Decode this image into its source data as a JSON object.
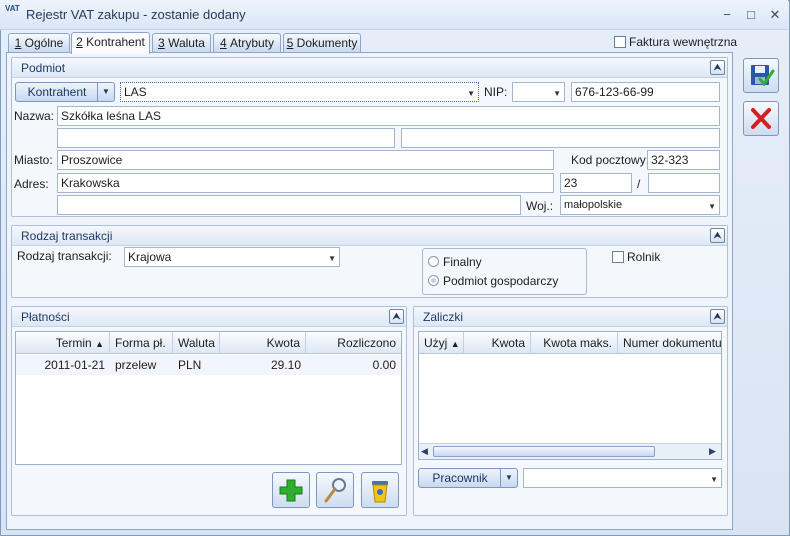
{
  "window": {
    "app_icon_text": "VAT",
    "title": "Rejestr VAT zakupu - zostanie dodany",
    "min_glyph": "−",
    "max_glyph": "□",
    "close_glyph": "✕"
  },
  "tabs": [
    {
      "num": "1",
      "label": "Ogólne"
    },
    {
      "num": "2",
      "label": "Kontrahent"
    },
    {
      "num": "3",
      "label": "Waluta"
    },
    {
      "num": "4",
      "label": "Atrybuty"
    },
    {
      "num": "5",
      "label": "Dokumenty"
    }
  ],
  "faktura_wewnetrzna": {
    "label": "Faktura wewnętrzna",
    "checked": false
  },
  "podmiot": {
    "title": "Podmiot",
    "kontrahent_button": "Kontrahent",
    "kontrahent_code": "LAS",
    "nip_label": "NIP:",
    "nip_prefix": "",
    "nip_value": "676-123-66-99",
    "nazwa_label": "Nazwa:",
    "nazwa_line1": "Szkółka leśna LAS",
    "nazwa_line2": "",
    "nazwa_line3": "",
    "miasto_label": "Miasto:",
    "miasto_value": "Proszowice",
    "kod_label": "Kod pocztowy:",
    "kod_value": "32-323",
    "adres_label": "Adres:",
    "adres_value": "Krakowska",
    "nr_domu": "23",
    "slash": "/",
    "nr_lokalu": "",
    "adres_line2": "",
    "woj_label": "Woj.:",
    "woj_value": "małopolskie"
  },
  "rodzaj": {
    "title": "Rodzaj transakcji",
    "label": "Rodzaj transakcji:",
    "value": "Krajowa",
    "opt_finalny": "Finalny",
    "opt_podmiot": "Podmiot gospodarczy",
    "selected": "Podmiot gospodarczy",
    "rolnik_label": "Rolnik",
    "rolnik_checked": false
  },
  "platnosci": {
    "title": "Płatności",
    "columns": [
      "Termin",
      "Forma pł.",
      "Waluta",
      "Kwota",
      "Rozliczono"
    ],
    "sort_glyph": "▲",
    "rows": [
      {
        "termin": "2011-01-21",
        "forma": "przelew",
        "waluta": "PLN",
        "kwota": "29.10",
        "rozliczono": "0.00"
      }
    ]
  },
  "zaliczki": {
    "title": "Zaliczki",
    "columns": [
      "Użyj",
      "Kwota",
      "Kwota maks.",
      "Numer dokumentu"
    ],
    "sort_glyph": "▲",
    "pracownik_button": "Pracownik",
    "pracownik_value": ""
  },
  "icons": {
    "collapse": "⮝",
    "scroll_left": "◀",
    "scroll_right": "▶",
    "dropdown": "▼"
  },
  "colors": {
    "add_green": "#2fae2f",
    "cancel_red": "#d42020",
    "save_blue": "#2a57a8"
  }
}
